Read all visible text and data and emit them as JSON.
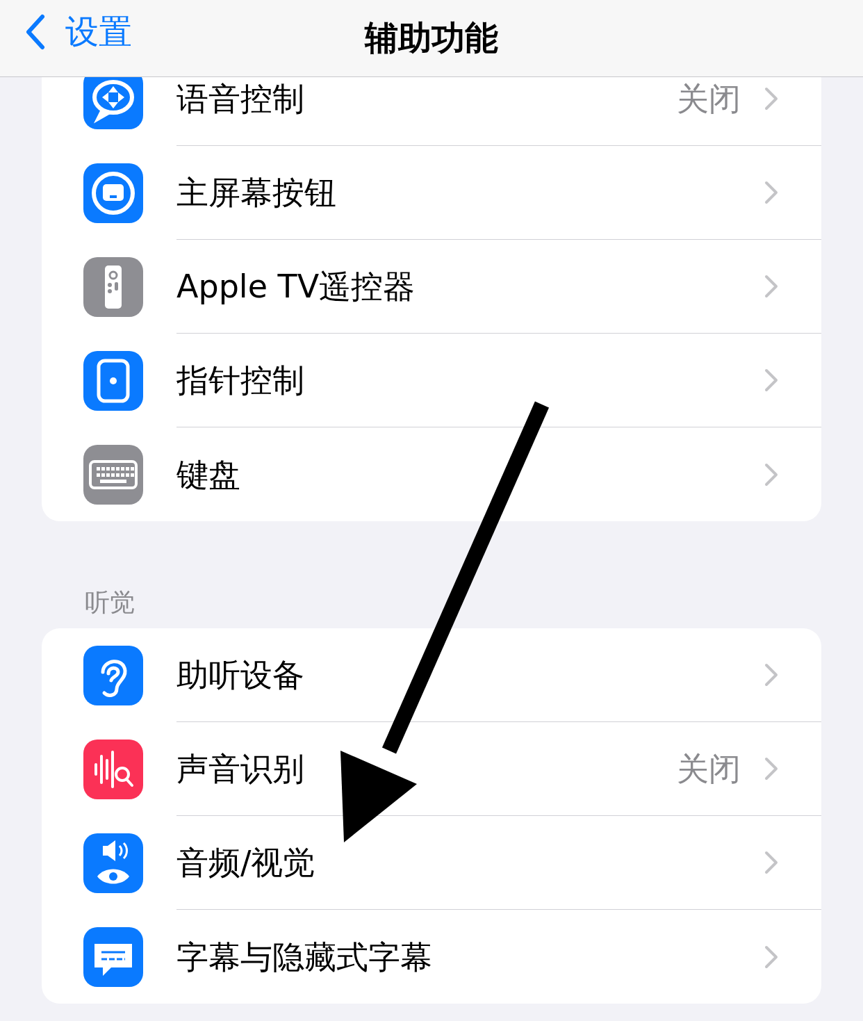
{
  "nav": {
    "back": "设置",
    "title": "辅助功能"
  },
  "groups": [
    {
      "rows": [
        {
          "label": "语音控制",
          "value": "关闭",
          "color": "#0a7aff"
        },
        {
          "label": "主屏幕按钮",
          "color": "#0a7aff"
        },
        {
          "label": "Apple TV遥控器",
          "color": "#8e8e93"
        },
        {
          "label": "指针控制",
          "color": "#0a7aff"
        },
        {
          "label": "键盘",
          "color": "#8e8e93"
        }
      ]
    },
    {
      "header": "听觉",
      "rows": [
        {
          "label": "助听设备",
          "color": "#0a7aff"
        },
        {
          "label": "声音识别",
          "value": "关闭",
          "color": "#fb3156"
        },
        {
          "label": "音频/视觉",
          "color": "#0a7aff"
        },
        {
          "label": "字幕与隐藏式字幕",
          "color": "#0a7aff"
        }
      ]
    }
  ]
}
